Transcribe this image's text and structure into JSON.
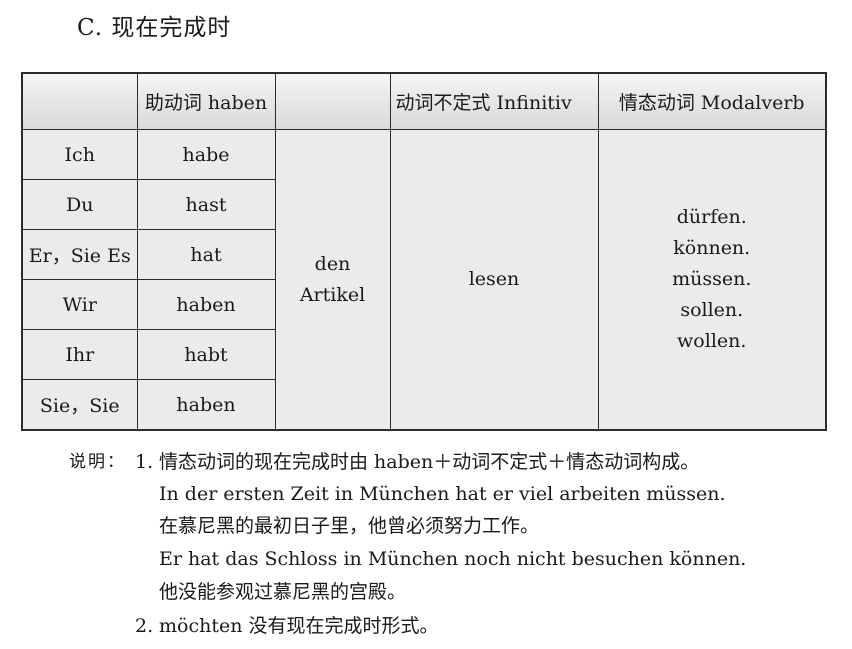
{
  "section_title": "C. 现在完成时",
  "table": {
    "headers": [
      "",
      "助动词 haben",
      "",
      "动词不定式 Infinitiv",
      "情态动词 Modalverb"
    ],
    "rows": [
      {
        "pronoun": "Ich",
        "haben": "habe"
      },
      {
        "pronoun": "Du",
        "haben": "hast"
      },
      {
        "pronoun": "Er，Sie Es",
        "haben": "hat"
      },
      {
        "pronoun": "Wir",
        "haben": "haben"
      },
      {
        "pronoun": "Ihr",
        "haben": "habt"
      },
      {
        "pronoun": "Sie，Sie",
        "haben": "haben"
      }
    ],
    "object_line1": "den",
    "object_line2": "Artikel",
    "infinitive": "lesen",
    "modal_verbs": [
      "dürfen.",
      "können.",
      "müssen.",
      "sollen.",
      "wollen."
    ]
  },
  "notes": {
    "label": "说明：",
    "item1_number": "1.",
    "item1_text": "情态动词的现在完成时由 haben＋动词不定式＋情态动词构成。",
    "example1_de": "In der ersten Zeit in München hat er viel arbeiten müssen.",
    "example1_zh": "在慕尼黑的最初日子里，他曾必须努力工作。",
    "example2_de": "Er hat das Schloss in München noch nicht besuchen können.",
    "example2_zh": "他没能参观过慕尼黑的宫殿。",
    "item2_number": "2.",
    "item2_text": "möchten  没有现在完成时形式。"
  }
}
